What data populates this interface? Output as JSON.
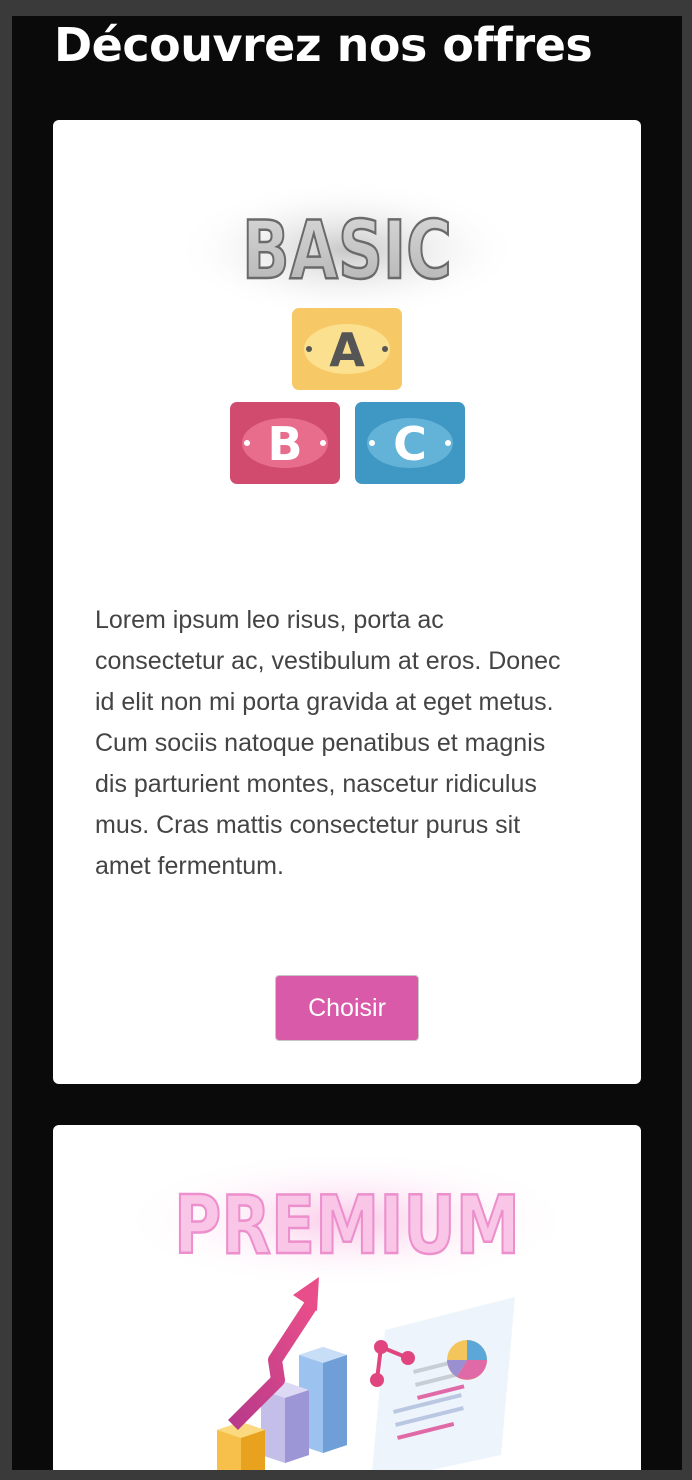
{
  "page": {
    "title": "Découvrez nos offres"
  },
  "offers": [
    {
      "badge": "BASIC",
      "blocks": [
        "A",
        "B",
        "C"
      ],
      "description": "Lorem ipsum leo risus, porta ac consectetur ac, vestibulum at eros. Donec id elit non mi porta gravida at eget metus. Cum sociis natoque penatibus et magnis dis parturient montes, nascetur ridiculus mus. Cras mattis consectetur purus sit amet fermentum.",
      "button_label": "Choisir"
    },
    {
      "badge": "PREMIUM"
    }
  ],
  "colors": {
    "background": "#0a0a0a",
    "card": "#ffffff",
    "accent_button": "#d85aa8",
    "block_a": "#f7c866",
    "block_b": "#d14b6e",
    "block_c": "#3f97c4",
    "premium_neon": "#f7b4e2"
  },
  "icons": [
    "abc-blocks-icon",
    "growth-chart-illustration-icon"
  ]
}
